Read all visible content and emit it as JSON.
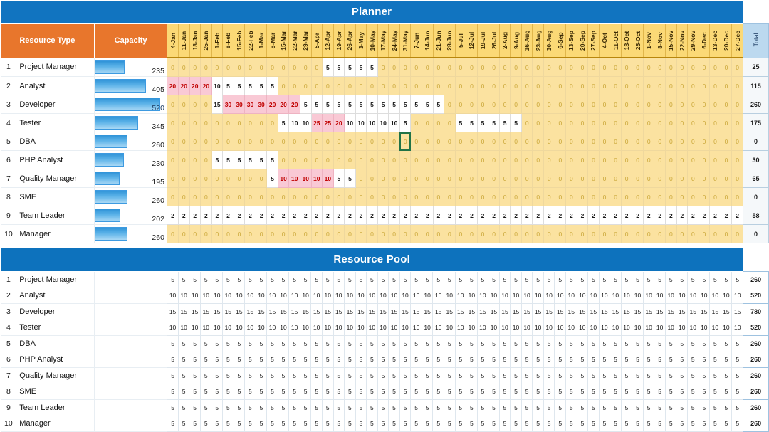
{
  "planner": {
    "title": "Planner",
    "columns": {
      "resource_type": "Resource Type",
      "capacity": "Capacity",
      "total": "Total"
    },
    "weeks": [
      "4-Jan",
      "11-Jan",
      "18-Jan",
      "25-Jan",
      "1-Feb",
      "8-Feb",
      "15-Feb",
      "22-Feb",
      "1-Mar",
      "8-Mar",
      "15-Mar",
      "22-Mar",
      "29-Mar",
      "5-Apr",
      "12-Apr",
      "19-Apr",
      "26-Apr",
      "3-May",
      "10-May",
      "17-May",
      "24-May",
      "31-May",
      "7-Jun",
      "14-Jun",
      "21-Jun",
      "28-Jun",
      "5-Jul",
      "12-Jul",
      "19-Jul",
      "26-Jul",
      "2-Aug",
      "9-Aug",
      "16-Aug",
      "23-Aug",
      "30-Aug",
      "6-Sep",
      "13-Sep",
      "20-Sep",
      "27-Sep",
      "4-Oct",
      "11-Oct",
      "18-Oct",
      "25-Oct",
      "1-Nov",
      "8-Nov",
      "15-Nov",
      "22-Nov",
      "29-Nov",
      "6-Dec",
      "13-Dec",
      "20-Dec",
      "27-Dec"
    ],
    "rows": [
      {
        "n": "1",
        "name": "Project Manager",
        "capacity": 235,
        "values": [
          0,
          0,
          0,
          0,
          0,
          0,
          0,
          0,
          0,
          0,
          0,
          0,
          0,
          0,
          5,
          5,
          5,
          5,
          5,
          0,
          0,
          0,
          0,
          0,
          0,
          0,
          0,
          0,
          0,
          0,
          0,
          0,
          0,
          0,
          0,
          0,
          0,
          0,
          0,
          0,
          0,
          0,
          0,
          0,
          0,
          0,
          0,
          0,
          0,
          0,
          0,
          0
        ],
        "over": [],
        "total": 25
      },
      {
        "n": "2",
        "name": "Analyst",
        "capacity": 405,
        "values": [
          20,
          20,
          20,
          20,
          10,
          5,
          5,
          5,
          5,
          5,
          0,
          0,
          0,
          0,
          0,
          0,
          0,
          0,
          0,
          0,
          0,
          0,
          0,
          0,
          0,
          0,
          0,
          0,
          0,
          0,
          0,
          0,
          0,
          0,
          0,
          0,
          0,
          0,
          0,
          0,
          0,
          0,
          0,
          0,
          0,
          0,
          0,
          0,
          0,
          0,
          0,
          0
        ],
        "over": [
          0,
          1,
          2,
          3
        ],
        "total": 115
      },
      {
        "n": "3",
        "name": "Developer",
        "capacity": 520,
        "values": [
          0,
          0,
          0,
          0,
          15,
          30,
          30,
          30,
          30,
          20,
          20,
          20,
          5,
          5,
          5,
          5,
          5,
          5,
          5,
          5,
          5,
          5,
          5,
          5,
          5,
          0,
          0,
          0,
          0,
          0,
          0,
          0,
          0,
          0,
          0,
          0,
          0,
          0,
          0,
          0,
          0,
          0,
          0,
          0,
          0,
          0,
          0,
          0,
          0,
          0,
          0,
          0
        ],
        "over": [
          5,
          6,
          7,
          8,
          9,
          10,
          11
        ],
        "total": 260
      },
      {
        "n": "4",
        "name": "Tester",
        "capacity": 345,
        "values": [
          0,
          0,
          0,
          0,
          0,
          0,
          0,
          0,
          0,
          0,
          5,
          10,
          10,
          25,
          25,
          20,
          10,
          10,
          10,
          10,
          10,
          5,
          0,
          0,
          0,
          0,
          5,
          5,
          5,
          5,
          5,
          5,
          0,
          0,
          0,
          0,
          0,
          0,
          0,
          0,
          0,
          0,
          0,
          0,
          0,
          0,
          0,
          0,
          0,
          0,
          0,
          0
        ],
        "over": [
          13,
          14,
          15
        ],
        "total": 175
      },
      {
        "n": "5",
        "name": "DBA",
        "capacity": 260,
        "values": [
          0,
          0,
          0,
          0,
          0,
          0,
          0,
          0,
          0,
          0,
          0,
          0,
          0,
          0,
          0,
          0,
          0,
          0,
          0,
          0,
          0,
          0,
          0,
          0,
          0,
          0,
          0,
          0,
          0,
          0,
          0,
          0,
          0,
          0,
          0,
          0,
          0,
          0,
          0,
          0,
          0,
          0,
          0,
          0,
          0,
          0,
          0,
          0,
          0,
          0,
          0,
          0
        ],
        "over": [],
        "selected": 21,
        "total": 0
      },
      {
        "n": "6",
        "name": "PHP Analyst",
        "capacity": 230,
        "values": [
          0,
          0,
          0,
          0,
          5,
          5,
          5,
          5,
          5,
          5,
          0,
          0,
          0,
          0,
          0,
          0,
          0,
          0,
          0,
          0,
          0,
          0,
          0,
          0,
          0,
          0,
          0,
          0,
          0,
          0,
          0,
          0,
          0,
          0,
          0,
          0,
          0,
          0,
          0,
          0,
          0,
          0,
          0,
          0,
          0,
          0,
          0,
          0,
          0,
          0,
          0,
          0
        ],
        "over": [],
        "total": 30
      },
      {
        "n": "7",
        "name": "Quality Manager",
        "capacity": 195,
        "values": [
          0,
          0,
          0,
          0,
          0,
          0,
          0,
          0,
          0,
          5,
          10,
          10,
          10,
          10,
          10,
          5,
          5,
          0,
          0,
          0,
          0,
          0,
          0,
          0,
          0,
          0,
          0,
          0,
          0,
          0,
          0,
          0,
          0,
          0,
          0,
          0,
          0,
          0,
          0,
          0,
          0,
          0,
          0,
          0,
          0,
          0,
          0,
          0,
          0,
          0,
          0,
          0
        ],
        "over": [
          10,
          11,
          12,
          13,
          14
        ],
        "total": 65
      },
      {
        "n": "8",
        "name": "SME",
        "capacity": 260,
        "values": [
          0,
          0,
          0,
          0,
          0,
          0,
          0,
          0,
          0,
          0,
          0,
          0,
          0,
          0,
          0,
          0,
          0,
          0,
          0,
          0,
          0,
          0,
          0,
          0,
          0,
          0,
          0,
          0,
          0,
          0,
          0,
          0,
          0,
          0,
          0,
          0,
          0,
          0,
          0,
          0,
          0,
          0,
          0,
          0,
          0,
          0,
          0,
          0,
          0,
          0,
          0,
          0
        ],
        "over": [],
        "total": 0
      },
      {
        "n": "9",
        "name": "Team Leader",
        "capacity": 202,
        "values": [
          2,
          2,
          2,
          2,
          2,
          2,
          2,
          2,
          2,
          2,
          2,
          2,
          2,
          2,
          2,
          2,
          2,
          2,
          2,
          2,
          2,
          2,
          2,
          2,
          2,
          2,
          2,
          2,
          2,
          2,
          2,
          2,
          2,
          2,
          2,
          2,
          2,
          2,
          2,
          2,
          2,
          2,
          2,
          2,
          2,
          2,
          2,
          2,
          2,
          2,
          2,
          2
        ],
        "over": [],
        "total": 58
      },
      {
        "n": "10",
        "name": "Manager",
        "capacity": 260,
        "values": [
          0,
          0,
          0,
          0,
          0,
          0,
          0,
          0,
          0,
          0,
          0,
          0,
          0,
          0,
          0,
          0,
          0,
          0,
          0,
          0,
          0,
          0,
          0,
          0,
          0,
          0,
          0,
          0,
          0,
          0,
          0,
          0,
          0,
          0,
          0,
          0,
          0,
          0,
          0,
          0,
          0,
          0,
          0,
          0,
          0,
          0,
          0,
          0,
          0,
          0,
          0,
          0
        ],
        "over": [],
        "total": 0
      }
    ]
  },
  "resource_pool": {
    "title": "Resource Pool",
    "rows": [
      {
        "n": "1",
        "name": "Project Manager",
        "per_week": 5,
        "total": 260
      },
      {
        "n": "2",
        "name": "Analyst",
        "per_week": 10,
        "total": 520
      },
      {
        "n": "3",
        "name": "Developer",
        "per_week": 15,
        "total": 780
      },
      {
        "n": "4",
        "name": "Tester",
        "per_week": 10,
        "total": 520
      },
      {
        "n": "5",
        "name": "DBA",
        "per_week": 5,
        "total": 260
      },
      {
        "n": "6",
        "name": "PHP Analyst",
        "per_week": 5,
        "total": 260
      },
      {
        "n": "7",
        "name": "Quality Manager",
        "per_week": 5,
        "total": 260
      },
      {
        "n": "8",
        "name": "SME",
        "per_week": 5,
        "total": 260
      },
      {
        "n": "9",
        "name": "Team Leader",
        "per_week": 5,
        "total": 260
      },
      {
        "n": "10",
        "name": "Manager",
        "per_week": 5,
        "total": 260
      }
    ]
  },
  "colors": {
    "title_blue": "#1174c0",
    "header_orange": "#e8762c",
    "week_yellow": "#fbe2a0",
    "over_pink": "#f9c9d5",
    "over_text": "#c00000",
    "bar_blue": "#3d9ae0",
    "total_header": "#bcd9ef"
  }
}
